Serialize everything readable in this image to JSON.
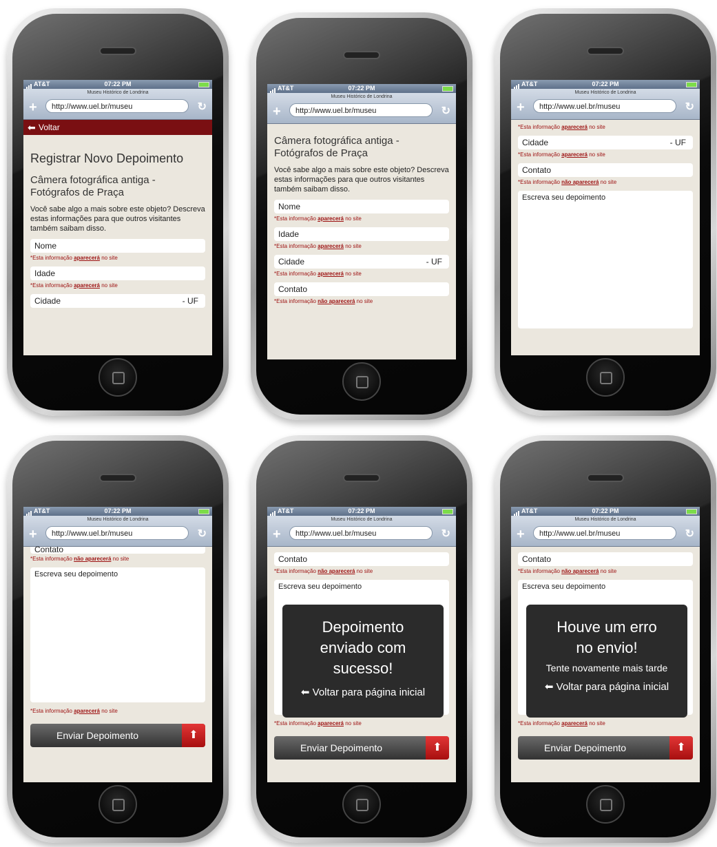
{
  "status": {
    "carrier": "AT&T",
    "time": "07:22 PM"
  },
  "browser": {
    "page_title": "Museu Histórico de Londrina",
    "url": "http://www.uel.br/museu",
    "plus": "+",
    "reload": "↻"
  },
  "back": {
    "label": "Voltar",
    "arrow": "⬅"
  },
  "form": {
    "title": "Registrar Novo Depoimento",
    "object": "Câmera fotográfica antiga - Fotógrafos de Praça",
    "intro": "Você sabe algo a mais sobre este objeto? Descreva estas informações para que outros visitantes também saibam disso.",
    "name": "Nome",
    "age": "Idade",
    "city": "Cidade",
    "uf": "- UF",
    "contact": "Contato",
    "testimony": "Escreva seu depoimento",
    "note_prefix": "*Esta informação",
    "note_appears": "aparecerá",
    "note_not_appears": "não aparecerá",
    "note_suffix": "no site",
    "send": "Enviar Depoimento",
    "send_icon": "⬆"
  },
  "success": {
    "line1": "Depoimento",
    "line2": "enviado com",
    "line3": "sucesso!",
    "back": "⬅ Voltar para página inicial"
  },
  "error": {
    "line1": "Houve um erro",
    "line2": "no envio!",
    "sub": "Tente novamente mais tarde",
    "back": "⬅ Voltar para página inicial"
  }
}
